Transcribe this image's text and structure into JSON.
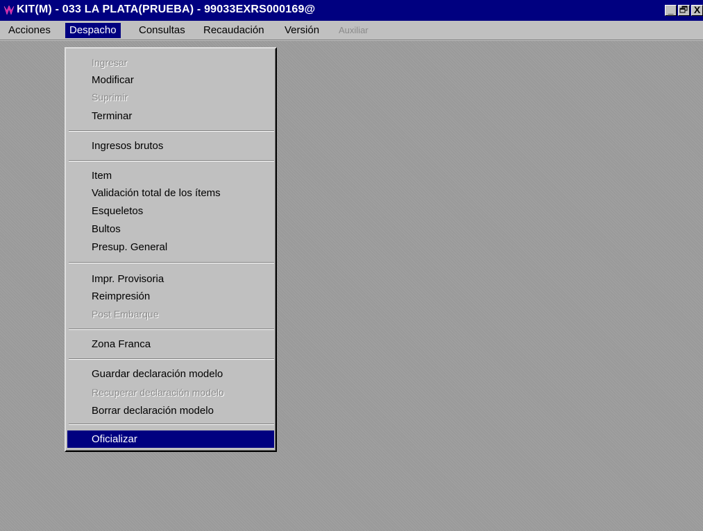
{
  "window": {
    "title": "KIT(M) - 033 LA PLATA(PRUEBA) - 99033EXRS000169@",
    "controls": {
      "minimize": "_",
      "restore": "ᴒ",
      "close": "X"
    }
  },
  "menubar": {
    "items": [
      {
        "label": "Acciones",
        "state": "normal"
      },
      {
        "label": "Despacho",
        "state": "open"
      },
      {
        "label": "Consultas",
        "state": "normal"
      },
      {
        "label": "Recaudación",
        "state": "normal"
      },
      {
        "label": "Versión",
        "state": "normal"
      },
      {
        "label": "Auxiliar",
        "state": "disabled"
      }
    ]
  },
  "despacho_menu": {
    "items": [
      {
        "label": "Ingresar",
        "enabled": false
      },
      {
        "label": "Modificar",
        "enabled": true
      },
      {
        "label": "Suprimir",
        "enabled": false
      },
      {
        "label": "Terminar",
        "enabled": true
      },
      {
        "label": "Ingresos brutos",
        "enabled": true
      },
      {
        "label": "Item",
        "enabled": true
      },
      {
        "label": "Validación total de los ítems",
        "enabled": true
      },
      {
        "label": "Esqueletos",
        "enabled": true
      },
      {
        "label": "Bultos",
        "enabled": true
      },
      {
        "label": "Presup. General",
        "enabled": true
      },
      {
        "label": "Impr. Provisoria",
        "enabled": true
      },
      {
        "label": "Reimpresión",
        "enabled": true
      },
      {
        "label": "Post Embarque",
        "enabled": false
      },
      {
        "label": "Zona Franca",
        "enabled": true
      },
      {
        "label": "Guardar declaración modelo",
        "enabled": true
      },
      {
        "label": "Recuperar declaración modelo",
        "enabled": false
      },
      {
        "label": "Borrar declaración modelo",
        "enabled": true
      },
      {
        "label": "Oficializar",
        "enabled": true,
        "selected": true
      }
    ]
  },
  "colors": {
    "titlebar": "#000080",
    "highlight": "#000080",
    "disabled_text": "#8a8a8a",
    "app_icon": "#d020a0"
  }
}
